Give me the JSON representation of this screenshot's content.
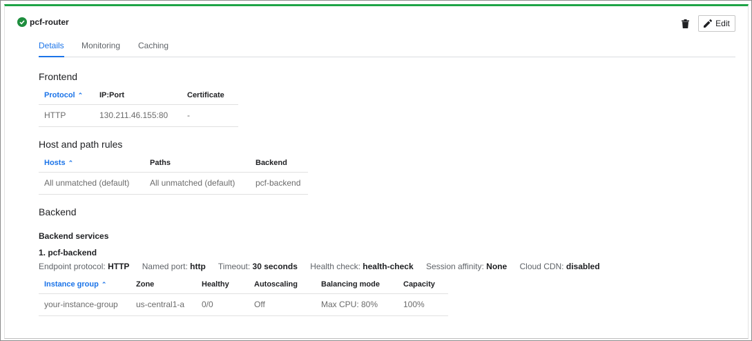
{
  "header": {
    "title": "pcf-router",
    "edit_label": "Edit",
    "status_icon": "check-circle-icon",
    "status_color": "#1e8e3e"
  },
  "tabs": [
    {
      "label": "Details"
    },
    {
      "label": "Monitoring"
    },
    {
      "label": "Caching"
    }
  ],
  "frontend": {
    "title": "Frontend",
    "columns": [
      "Protocol",
      "IP:Port",
      "Certificate"
    ],
    "rows": [
      [
        "HTTP",
        "130.211.46.155:80",
        "-"
      ]
    ]
  },
  "host_rules": {
    "title": "Host and path rules",
    "columns": [
      "Hosts",
      "Paths",
      "Backend"
    ],
    "rows": [
      [
        "All unmatched (default)",
        "All unmatched (default)",
        "pcf-backend"
      ]
    ]
  },
  "backend": {
    "title": "Backend",
    "services_heading": "Backend services",
    "service_name": "1. pcf-backend",
    "endpoint_protocol_label": "Endpoint protocol:",
    "endpoint_protocol": "HTTP",
    "named_port_label": "Named port:",
    "named_port": "http",
    "timeout_label": "Timeout:",
    "timeout": "30 seconds",
    "health_check_label": "Health check:",
    "health_check": "health-check",
    "session_affinity_label": "Session affinity:",
    "session_affinity": "None",
    "cdn_label": "Cloud CDN:",
    "cdn": "disabled",
    "columns": [
      "Instance group",
      "Zone",
      "Healthy",
      "Autoscaling",
      "Balancing mode",
      "Capacity"
    ],
    "rows": [
      [
        "your-instance-group",
        "us-central1-a",
        "0/0",
        "Off",
        "Max CPU: 80%",
        "100%"
      ]
    ]
  },
  "colors": {
    "accent": "#1a73e8",
    "top_bar": "#1ea446"
  }
}
